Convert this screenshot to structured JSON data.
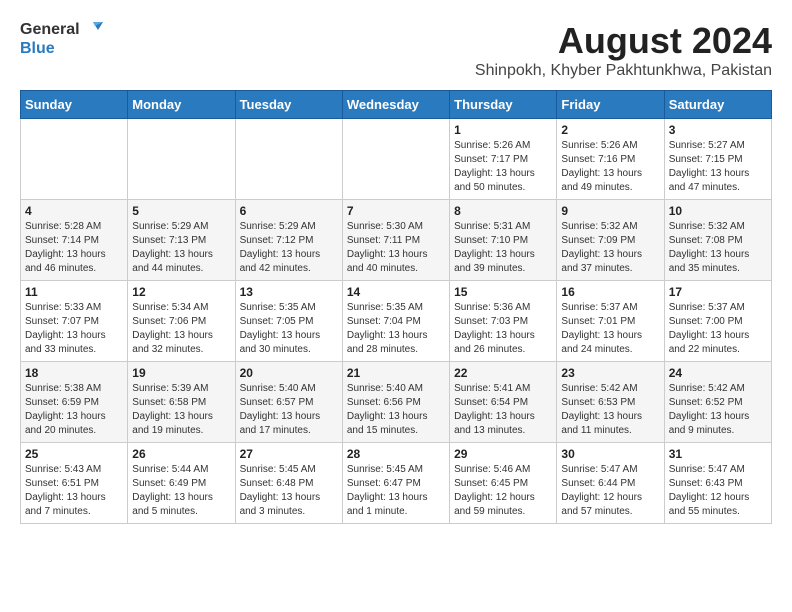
{
  "header": {
    "logo_line1": "General",
    "logo_line2": "Blue",
    "title": "August 2024",
    "subtitle": "Shinpokh, Khyber Pakhtunkhwa, Pakistan"
  },
  "days_of_week": [
    "Sunday",
    "Monday",
    "Tuesday",
    "Wednesday",
    "Thursday",
    "Friday",
    "Saturday"
  ],
  "weeks": [
    [
      {
        "day": "",
        "info": ""
      },
      {
        "day": "",
        "info": ""
      },
      {
        "day": "",
        "info": ""
      },
      {
        "day": "",
        "info": ""
      },
      {
        "day": "1",
        "info": "Sunrise: 5:26 AM\nSunset: 7:17 PM\nDaylight: 13 hours\nand 50 minutes."
      },
      {
        "day": "2",
        "info": "Sunrise: 5:26 AM\nSunset: 7:16 PM\nDaylight: 13 hours\nand 49 minutes."
      },
      {
        "day": "3",
        "info": "Sunrise: 5:27 AM\nSunset: 7:15 PM\nDaylight: 13 hours\nand 47 minutes."
      }
    ],
    [
      {
        "day": "4",
        "info": "Sunrise: 5:28 AM\nSunset: 7:14 PM\nDaylight: 13 hours\nand 46 minutes."
      },
      {
        "day": "5",
        "info": "Sunrise: 5:29 AM\nSunset: 7:13 PM\nDaylight: 13 hours\nand 44 minutes."
      },
      {
        "day": "6",
        "info": "Sunrise: 5:29 AM\nSunset: 7:12 PM\nDaylight: 13 hours\nand 42 minutes."
      },
      {
        "day": "7",
        "info": "Sunrise: 5:30 AM\nSunset: 7:11 PM\nDaylight: 13 hours\nand 40 minutes."
      },
      {
        "day": "8",
        "info": "Sunrise: 5:31 AM\nSunset: 7:10 PM\nDaylight: 13 hours\nand 39 minutes."
      },
      {
        "day": "9",
        "info": "Sunrise: 5:32 AM\nSunset: 7:09 PM\nDaylight: 13 hours\nand 37 minutes."
      },
      {
        "day": "10",
        "info": "Sunrise: 5:32 AM\nSunset: 7:08 PM\nDaylight: 13 hours\nand 35 minutes."
      }
    ],
    [
      {
        "day": "11",
        "info": "Sunrise: 5:33 AM\nSunset: 7:07 PM\nDaylight: 13 hours\nand 33 minutes."
      },
      {
        "day": "12",
        "info": "Sunrise: 5:34 AM\nSunset: 7:06 PM\nDaylight: 13 hours\nand 32 minutes."
      },
      {
        "day": "13",
        "info": "Sunrise: 5:35 AM\nSunset: 7:05 PM\nDaylight: 13 hours\nand 30 minutes."
      },
      {
        "day": "14",
        "info": "Sunrise: 5:35 AM\nSunset: 7:04 PM\nDaylight: 13 hours\nand 28 minutes."
      },
      {
        "day": "15",
        "info": "Sunrise: 5:36 AM\nSunset: 7:03 PM\nDaylight: 13 hours\nand 26 minutes."
      },
      {
        "day": "16",
        "info": "Sunrise: 5:37 AM\nSunset: 7:01 PM\nDaylight: 13 hours\nand 24 minutes."
      },
      {
        "day": "17",
        "info": "Sunrise: 5:37 AM\nSunset: 7:00 PM\nDaylight: 13 hours\nand 22 minutes."
      }
    ],
    [
      {
        "day": "18",
        "info": "Sunrise: 5:38 AM\nSunset: 6:59 PM\nDaylight: 13 hours\nand 20 minutes."
      },
      {
        "day": "19",
        "info": "Sunrise: 5:39 AM\nSunset: 6:58 PM\nDaylight: 13 hours\nand 19 minutes."
      },
      {
        "day": "20",
        "info": "Sunrise: 5:40 AM\nSunset: 6:57 PM\nDaylight: 13 hours\nand 17 minutes."
      },
      {
        "day": "21",
        "info": "Sunrise: 5:40 AM\nSunset: 6:56 PM\nDaylight: 13 hours\nand 15 minutes."
      },
      {
        "day": "22",
        "info": "Sunrise: 5:41 AM\nSunset: 6:54 PM\nDaylight: 13 hours\nand 13 minutes."
      },
      {
        "day": "23",
        "info": "Sunrise: 5:42 AM\nSunset: 6:53 PM\nDaylight: 13 hours\nand 11 minutes."
      },
      {
        "day": "24",
        "info": "Sunrise: 5:42 AM\nSunset: 6:52 PM\nDaylight: 13 hours\nand 9 minutes."
      }
    ],
    [
      {
        "day": "25",
        "info": "Sunrise: 5:43 AM\nSunset: 6:51 PM\nDaylight: 13 hours\nand 7 minutes."
      },
      {
        "day": "26",
        "info": "Sunrise: 5:44 AM\nSunset: 6:49 PM\nDaylight: 13 hours\nand 5 minutes."
      },
      {
        "day": "27",
        "info": "Sunrise: 5:45 AM\nSunset: 6:48 PM\nDaylight: 13 hours\nand 3 minutes."
      },
      {
        "day": "28",
        "info": "Sunrise: 5:45 AM\nSunset: 6:47 PM\nDaylight: 13 hours\nand 1 minute."
      },
      {
        "day": "29",
        "info": "Sunrise: 5:46 AM\nSunset: 6:45 PM\nDaylight: 12 hours\nand 59 minutes."
      },
      {
        "day": "30",
        "info": "Sunrise: 5:47 AM\nSunset: 6:44 PM\nDaylight: 12 hours\nand 57 minutes."
      },
      {
        "day": "31",
        "info": "Sunrise: 5:47 AM\nSunset: 6:43 PM\nDaylight: 12 hours\nand 55 minutes."
      }
    ]
  ]
}
